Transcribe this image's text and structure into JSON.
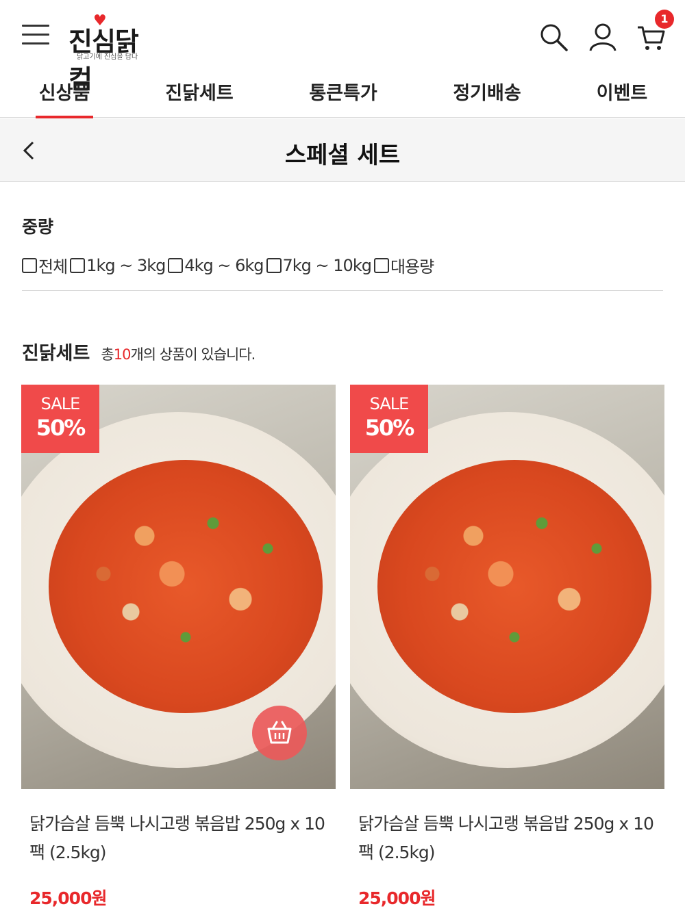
{
  "header": {
    "logo_text": "진심닭컴",
    "logo_tagline": "닭고기에 진심을 담다",
    "cart_count": "1"
  },
  "nav": {
    "tabs": [
      {
        "label": "신상품",
        "active": true
      },
      {
        "label": "진닭세트",
        "active": false
      },
      {
        "label": "통큰특가",
        "active": false
      },
      {
        "label": "정기배송",
        "active": false
      },
      {
        "label": "이벤트",
        "active": false
      }
    ]
  },
  "page": {
    "title": "스페셜 세트"
  },
  "filter": {
    "title": "중량",
    "options": [
      "전체",
      "1kg ~ 3kg",
      "4kg ~ 6kg",
      "7kg ~ 10kg",
      "대용량"
    ]
  },
  "section": {
    "title": "진닭세트",
    "count_prefix": "총",
    "count": "10",
    "count_suffix": "개의 상품이 있습니다."
  },
  "products": [
    {
      "badge_label": "SALE",
      "badge_value": "50%",
      "name": "닭가슴살 듬뿍 나시고랭 볶음밥 250g x 10팩 (2.5kg)",
      "price": "25,000원"
    },
    {
      "badge_label": "SALE",
      "badge_value": "50%",
      "name": "닭가슴살 듬뿍 나시고랭 볶음밥 250g x 10팩 (2.5kg)",
      "price": "25,000원"
    }
  ],
  "colors": {
    "accent": "#e8282b",
    "badge": "#f04a4a"
  }
}
